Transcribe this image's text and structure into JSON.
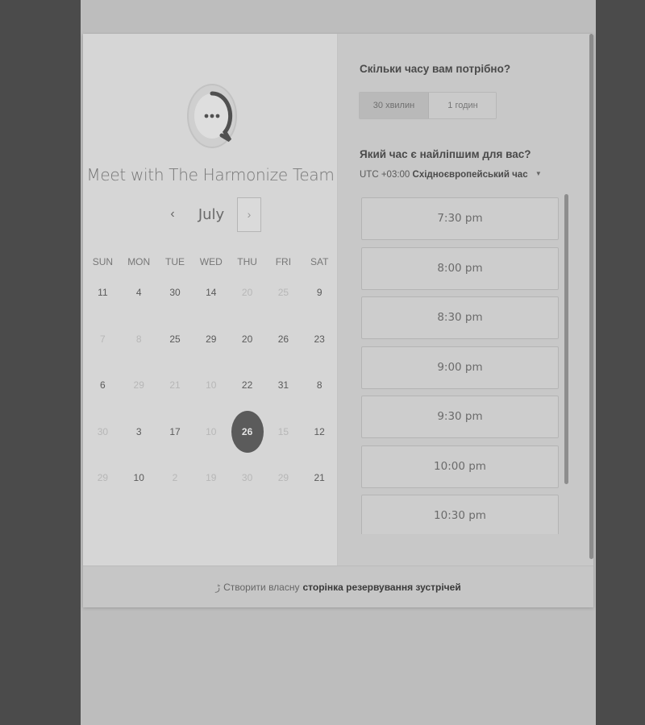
{
  "booking": {
    "team_title": "Meet with The Harmonize Team",
    "month": "July",
    "prev_icon": "‹",
    "next_icon": "›"
  },
  "calendar": {
    "days_of_week": [
      "SUN",
      "MON",
      "TUE",
      "WED",
      "THU",
      "FRI",
      "SAT"
    ],
    "weeks": [
      [
        {
          "d": "11",
          "m": false
        },
        {
          "d": "4",
          "m": false
        },
        {
          "d": "30",
          "m": false
        },
        {
          "d": "14",
          "m": false
        },
        {
          "d": "20",
          "m": true
        },
        {
          "d": "25",
          "m": true
        },
        {
          "d": "9",
          "m": false
        }
      ],
      [
        {
          "d": "7",
          "m": true
        },
        {
          "d": "8",
          "m": true
        },
        {
          "d": "25",
          "m": false
        },
        {
          "d": "29",
          "m": false
        },
        {
          "d": "20",
          "m": false
        },
        {
          "d": "26",
          "m": false
        },
        {
          "d": "23",
          "m": false
        }
      ],
      [
        {
          "d": "6",
          "m": false
        },
        {
          "d": "29",
          "m": true
        },
        {
          "d": "21",
          "m": true
        },
        {
          "d": "10",
          "m": true
        },
        {
          "d": "22",
          "m": false
        },
        {
          "d": "31",
          "m": false
        },
        {
          "d": "8",
          "m": false
        }
      ],
      [
        {
          "d": "30",
          "m": true
        },
        {
          "d": "3",
          "m": false
        },
        {
          "d": "17",
          "m": false
        },
        {
          "d": "10",
          "m": true
        },
        {
          "d": "26",
          "m": false,
          "selected": true
        },
        {
          "d": "15",
          "m": true
        },
        {
          "d": "12",
          "m": false
        }
      ],
      [
        {
          "d": "29",
          "m": true
        },
        {
          "d": "10",
          "m": false
        },
        {
          "d": "2",
          "m": true
        },
        {
          "d": "19",
          "m": true
        },
        {
          "d": "30",
          "m": true
        },
        {
          "d": "29",
          "m": true
        },
        {
          "d": "21",
          "m": false
        }
      ]
    ]
  },
  "scheduler": {
    "duration_question": "Скільки часу вам потрібно?",
    "durations": [
      {
        "label": "30 хвилин",
        "active": true
      },
      {
        "label": "1 годин",
        "active": false
      }
    ],
    "time_question": "Який час є найліпшим для вас?",
    "timezone_offset": "UTC +03:00",
    "timezone_name": "Східноєвропейський час",
    "slots": [
      "7:30 pm",
      "8:00 pm",
      "8:30 pm",
      "9:00 pm",
      "9:30 pm",
      "10:00 pm",
      "10:30 pm"
    ]
  },
  "footer": {
    "prefix": "Створити власну",
    "link": "сторінка резервування зустрічей"
  },
  "colors": {
    "selected_day": "#5b5b5b",
    "background": "#4b4b4b"
  }
}
